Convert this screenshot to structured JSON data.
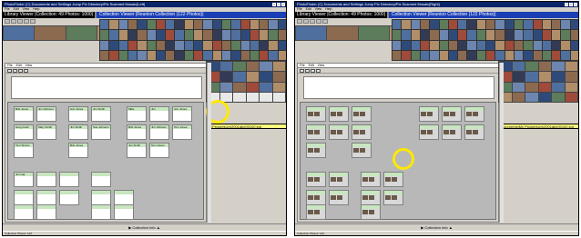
{
  "left": {
    "title": "PhotoFinder (C) Documents and Settings Jump Pix Directory\\Pix Scanned Mosaic[Left]",
    "menu": [
      "File",
      "Edit",
      "View",
      "Help"
    ],
    "app_header": "Library Viewer  |Collection:  49 Photos: 1000|",
    "viewer_header": "Collection Viewer   |Reunion Collection (122 Photos)|",
    "path": "\\Pictures\\ch\\2001abc00100.jpg",
    "collection_info": "Collection Info",
    "status": "Collection Photos: 122",
    "card_labels": [
      "Bob Jones",
      "Jim Johnson",
      "Ann Jones",
      "Jim Smith",
      "Greg Gosh",
      "Mary Smith",
      "Jim Smith",
      "Sue Johnson",
      "Tom Simms",
      "Bob Jones",
      "Mike",
      "Jim",
      "Ann Jones",
      "Bob Jones",
      "Jim Johnson",
      "Tom Jones",
      "Jim Smith",
      "Tom Jones",
      "Jim Gal"
    ]
  },
  "right": {
    "title": "PhotoFinder (C) Documents and Settings Jump Pix Directory\\Pix Scanned Mosaic[Right]",
    "menu": [
      "File",
      "Edit",
      "View",
      "Help"
    ],
    "app_header": "Library Viewer  |Collection:  49 Photos: 1000|",
    "viewer_header": "Collection Viewer   |Reunion Collection (122 Photos)|",
    "path": "ournents\\My Pictures\\ch\\2001abc00100.jpg",
    "collection_info": "Collection Info",
    "status": "Collection Photos: 122"
  }
}
